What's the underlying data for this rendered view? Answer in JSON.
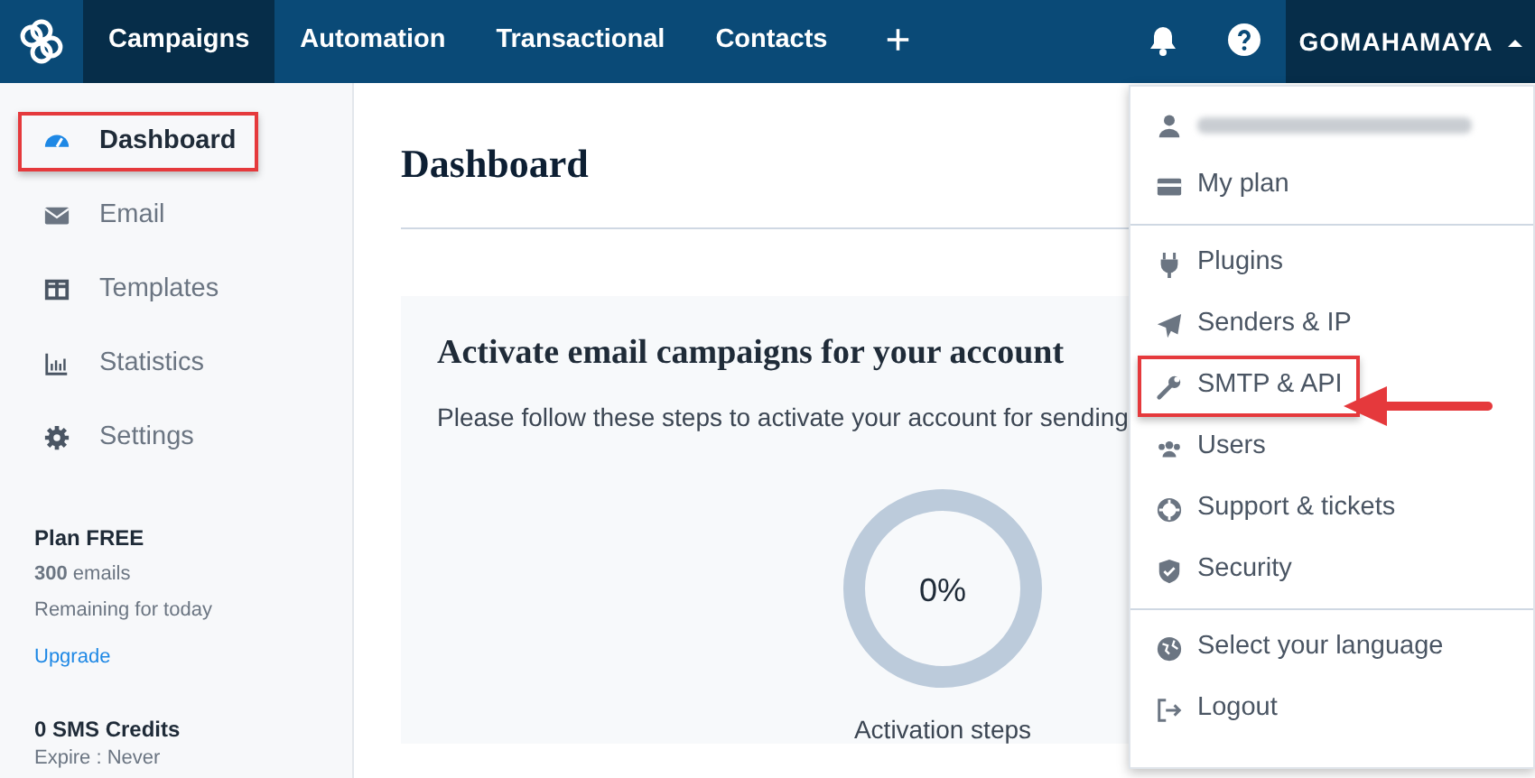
{
  "navbar": {
    "tabs": [
      {
        "label": "Campaigns",
        "selected": true
      },
      {
        "label": "Automation",
        "selected": false
      },
      {
        "label": "Transactional",
        "selected": false
      },
      {
        "label": "Contacts",
        "selected": false
      }
    ],
    "add": "+",
    "account": {
      "label": "GOMAHAMAYA",
      "expanded": true
    }
  },
  "sidebar": {
    "items": [
      {
        "label": "Dashboard",
        "selected": true,
        "highlighted": true
      },
      {
        "label": "Email",
        "selected": false,
        "highlighted": false
      },
      {
        "label": "Templates",
        "selected": false,
        "highlighted": false
      },
      {
        "label": "Statistics",
        "selected": false,
        "highlighted": false
      },
      {
        "label": "Settings",
        "selected": false,
        "highlighted": false
      }
    ],
    "plan": {
      "title": "Plan FREE",
      "emails": "**300** emails",
      "remaining": "Remaining for today",
      "upgrade": "Upgrade"
    },
    "sms": {
      "title": "0 SMS Credits",
      "expire": "Expire : Never"
    }
  },
  "main": {
    "title": "Dashboard",
    "card": {
      "heading": "Activate email campaigns for your account",
      "text": "Please follow these steps to activate your account for sending",
      "progress": {
        "value": "0%",
        "caption": "Activation steps"
      }
    }
  },
  "account_menu": {
    "groups": [
      [
        {
          "kind": "blurred",
          "highlighted": false
        },
        {
          "label": "My plan",
          "highlighted": false
        }
      ],
      [
        {
          "label": "Plugins",
          "highlighted": false
        },
        {
          "label": "Senders & IP",
          "highlighted": false
        },
        {
          "label": "SMTP & API",
          "highlighted": true
        },
        {
          "label": "Users",
          "highlighted": false
        },
        {
          "label": "Support & tickets",
          "highlighted": false
        },
        {
          "label": "Security",
          "highlighted": false
        }
      ],
      [
        {
          "label": "Select your language",
          "highlighted": false
        },
        {
          "label": "Logout",
          "highlighted": false
        }
      ]
    ]
  }
}
